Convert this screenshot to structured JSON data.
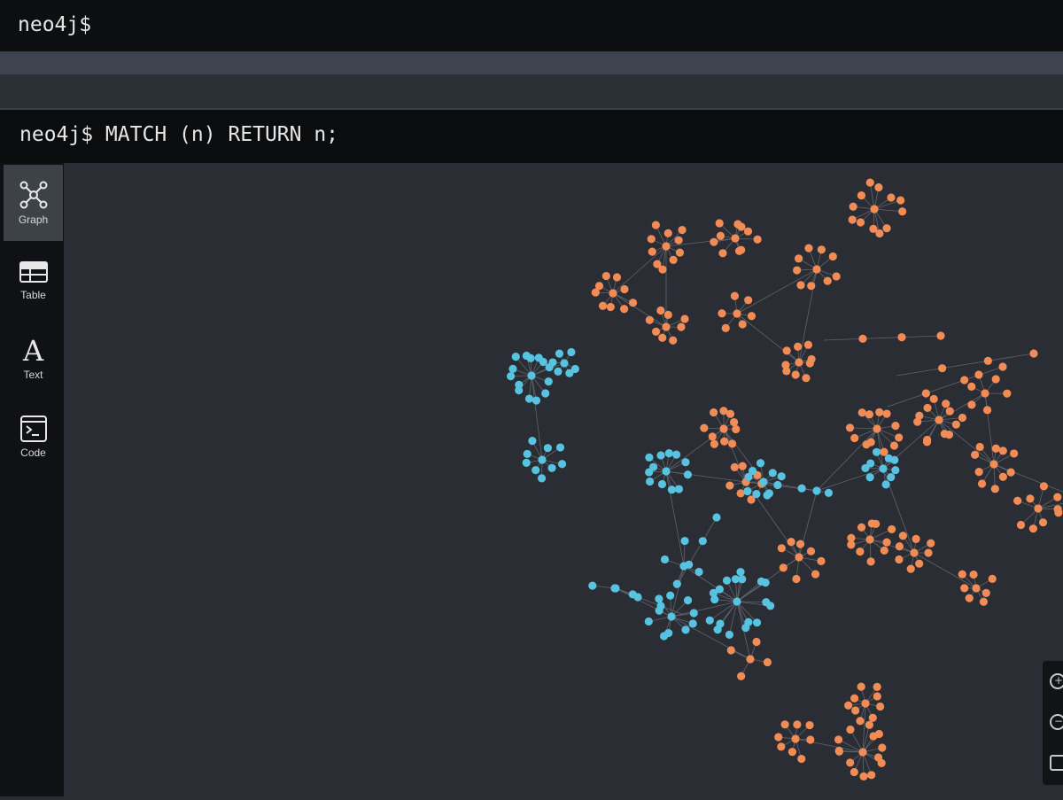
{
  "top_prompt": "neo4j$",
  "frame": {
    "command": "neo4j$ MATCH (n) RETURN n;"
  },
  "nav": [
    {
      "label": "Graph",
      "icon": "graph-icon",
      "active": true
    },
    {
      "label": "Table",
      "icon": "table-icon",
      "active": false
    },
    {
      "label": "Text",
      "icon": "text-icon",
      "active": false
    },
    {
      "label": "Code",
      "icon": "code-icon",
      "active": false
    }
  ],
  "zoom": {
    "controls": [
      "zoom-in-icon",
      "zoom-out-icon",
      "fit-icon"
    ]
  },
  "colors": {
    "orange_node": "#f28c57",
    "blue_node": "#57c3e0",
    "edge": "#5f646d"
  }
}
